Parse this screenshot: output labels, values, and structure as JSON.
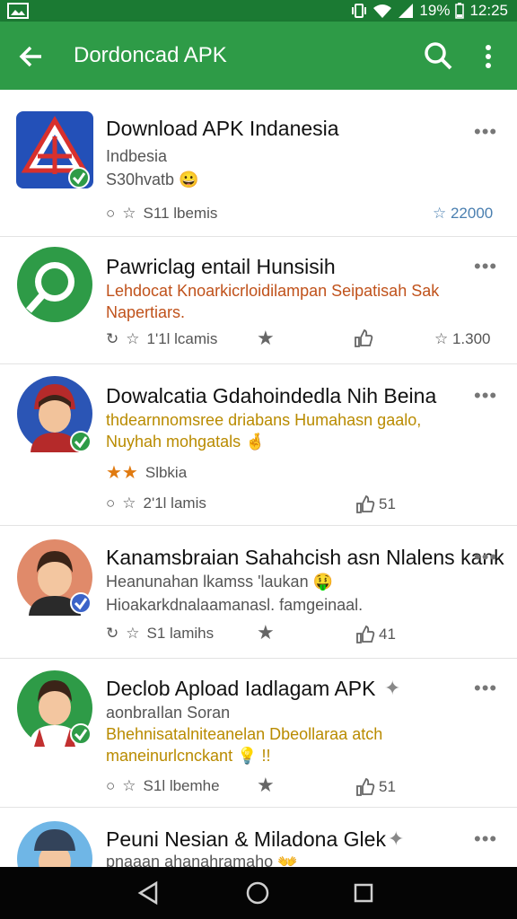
{
  "status_bar": {
    "battery": "19%",
    "time": "12:25"
  },
  "app_bar": {
    "title": "Dordoncad APK"
  },
  "items": [
    {
      "name": "Download APK Indanesia",
      "line1": "Indbesia",
      "line2": "S30hvatb 😀",
      "downloads": "S11 lbemis",
      "rating": "☆ 22000"
    },
    {
      "name": "Pawriclag entail Hunsisih",
      "line1": "Lehdocat Knoarkicrloidilampan Seipatisah Sak",
      "line2": "Napertiars.",
      "downloads": "1'1l lcamis",
      "rating": "☆ 1.300"
    },
    {
      "name": "Dowalcatia Gdahoindedla Nih Beina",
      "line1": "thdearnnomsree driabans Humahasn gaalo,",
      "line2": "Nuyhah mohgatals 🤞",
      "stars_text": "Slbkia",
      "downloads": "2'1l lamis",
      "thumb_count": "51"
    },
    {
      "name": "Kanamsbraian Sahahcish asn Nlalens kank",
      "line1": "Heanunahan lkamss 'laukan 🤑",
      "line2": "Hioakarkdnalaamanasl. famgeinaal.",
      "downloads": "S1 lamihs",
      "thumb_count": "41"
    },
    {
      "name": "Declob Apload Iadlagam APK",
      "line1": "aonbraIlan Soran",
      "line2": "Bhehnisatalniteanelan Dbeollaraa atch",
      "line3": "maneinurlcnckant 💡 !!",
      "downloads": "S1l lbemhe",
      "thumb_count": "51"
    },
    {
      "name": "Peuni Nesian & Miladona Glek",
      "line1": "pnaaan ahanahramaho 👐"
    }
  ],
  "colors": {
    "status_bar": "#1b7a33",
    "app_bar": "#2e9b47",
    "accent_green": "#2e9b47",
    "orange_text": "#c0521b",
    "gold_text": "#b98b00",
    "rating_blue": "#4a7fb0"
  },
  "icons": {
    "back": "arrow-left-icon",
    "search": "search-icon",
    "overflow": "more-vert-icon",
    "nav_back": "triangle-back-icon",
    "nav_home": "circle-home-icon",
    "nav_recents": "square-recents-icon"
  }
}
